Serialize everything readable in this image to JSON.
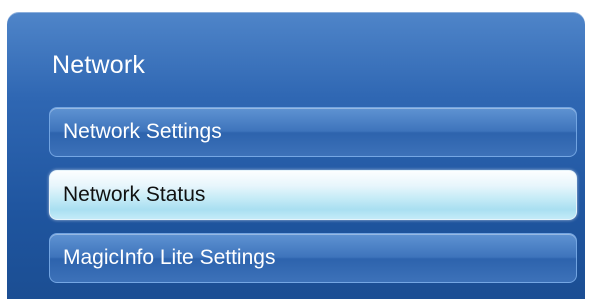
{
  "menu": {
    "title": "Network",
    "items": [
      {
        "label": "Network Settings",
        "selected": false
      },
      {
        "label": "Network Status",
        "selected": true
      },
      {
        "label": "MagicInfo Lite Settings",
        "selected": false
      }
    ]
  },
  "colors": {
    "panel_background": "#2f67b3",
    "item_normal": "#3e74bc",
    "item_selected": "#c8ecf7",
    "text_normal": "#ffffff",
    "text_selected": "#111111"
  }
}
